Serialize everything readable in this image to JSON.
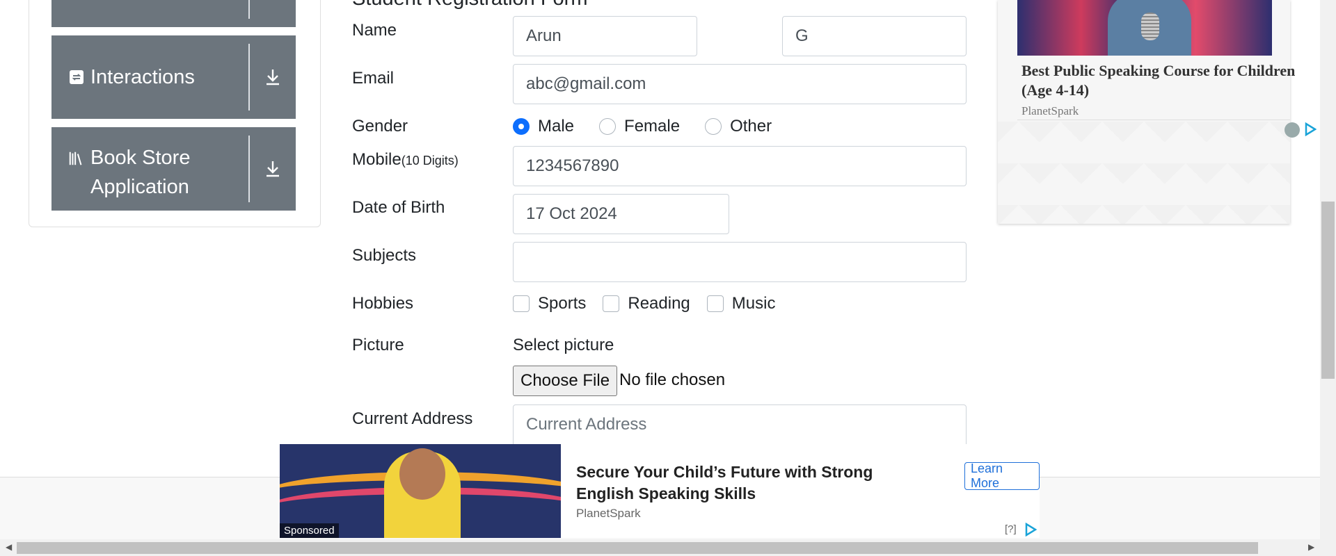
{
  "sidebar": {
    "groups": [
      {
        "label": ""
      },
      {
        "label": "Interactions",
        "icon": "swap-icon"
      },
      {
        "label_line1": "Book Store",
        "label_line2": "Application",
        "icon": "books-icon"
      }
    ]
  },
  "form": {
    "title": "Student Registration Form",
    "name": {
      "label": "Name",
      "first_name": "Arun",
      "last_name": "G"
    },
    "email": {
      "label": "Email",
      "value": "abc@gmail.com"
    },
    "gender": {
      "label": "Gender",
      "options": [
        "Male",
        "Female",
        "Other"
      ],
      "selected": "Male"
    },
    "mobile": {
      "label": "Mobile",
      "hint": "(10 Digits)",
      "value": "1234567890"
    },
    "dob": {
      "label": "Date of Birth",
      "value": "17 Oct 2024"
    },
    "subjects": {
      "label": "Subjects",
      "value": ""
    },
    "hobbies": {
      "label": "Hobbies",
      "options": [
        "Sports",
        "Reading",
        "Music"
      ]
    },
    "picture": {
      "label": "Picture",
      "sublabel": "Select picture",
      "button": "Choose File",
      "status": "No file chosen"
    },
    "address": {
      "label": "Current Address",
      "placeholder": "Current Address"
    }
  },
  "ad_right": {
    "headline": "Best Public Speaking Course for Children (Age 4-14)",
    "brand": "PlanetSpark"
  },
  "ad_bottom": {
    "sponsored": "Sponsored",
    "headline": "Secure Your Child’s Future with Strong English Speaking Skills",
    "brand": "PlanetSpark",
    "cta": "Learn More",
    "help": "[?]"
  },
  "colors": {
    "accent": "#0d6efd",
    "sidebar_group": "#6c757d",
    "ad_cta": "#1e6fd9"
  }
}
